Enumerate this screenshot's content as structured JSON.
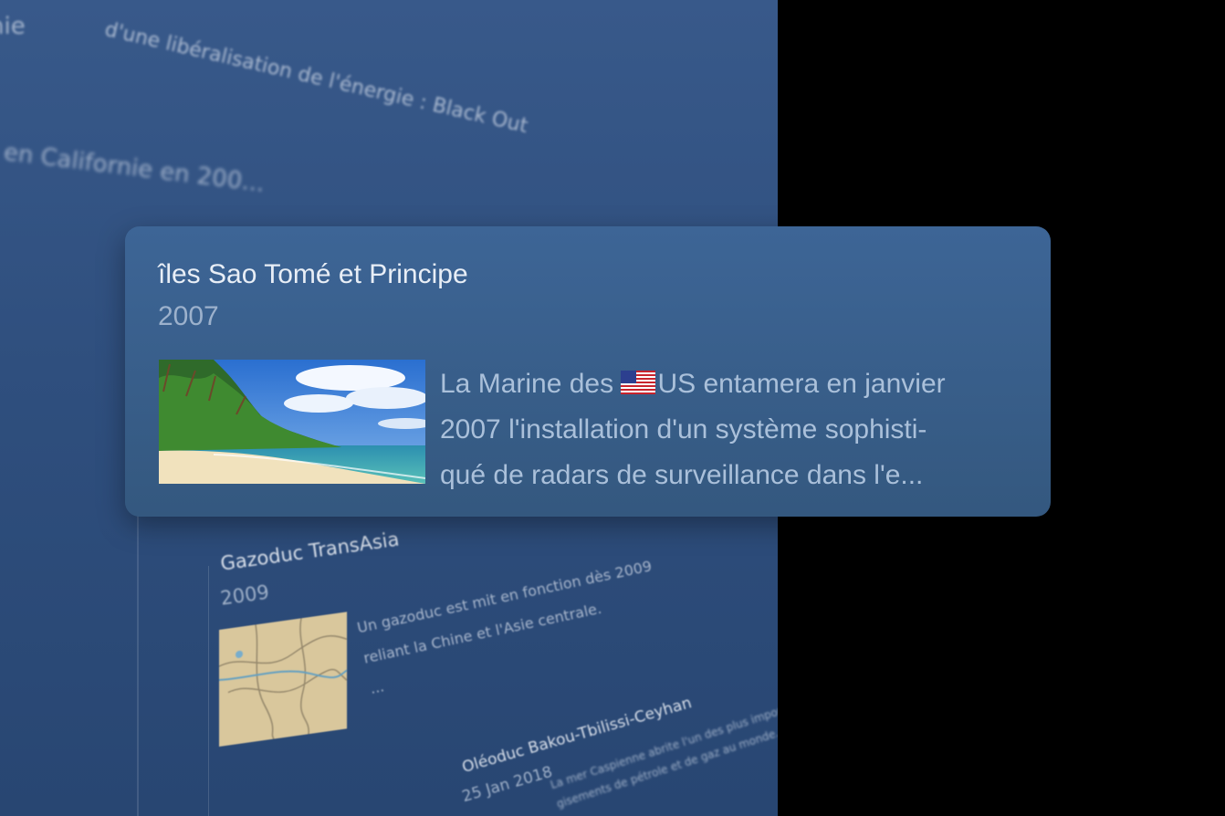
{
  "background": {
    "line1": "nie",
    "line1_prefix": "d'une libéralisation de l'énergie : Black Out",
    "line2": "en Californie en 200...",
    "cards": [
      {
        "title": "Gazoduc TransAsia",
        "year": "2009",
        "description": "Un gazoduc est mit en fonction dès 2009\nreliant la Chine et l'Asie centrale.\n..."
      },
      {
        "title": "Oléoduc Bakou-Tbilissi-Ceyhan",
        "date": "25 Jan 2018",
        "description": "La mer Caspienne abrite l'un des plus importants\ngisements de pétrole et de gaz au monde..."
      }
    ]
  },
  "focused_card": {
    "title": "îles Sao Tomé et Principe",
    "year": "2007",
    "image_alt_icon": "beach-photo",
    "description_line1_before_flag": "La Marine des ",
    "flag_icon": "us-flag-icon",
    "description_line1_after_flag": "US entamera en janvier",
    "description_rest": "2007 l'installation d'un système sophisti-\nqué de radars de surveillance dans l'e..."
  }
}
